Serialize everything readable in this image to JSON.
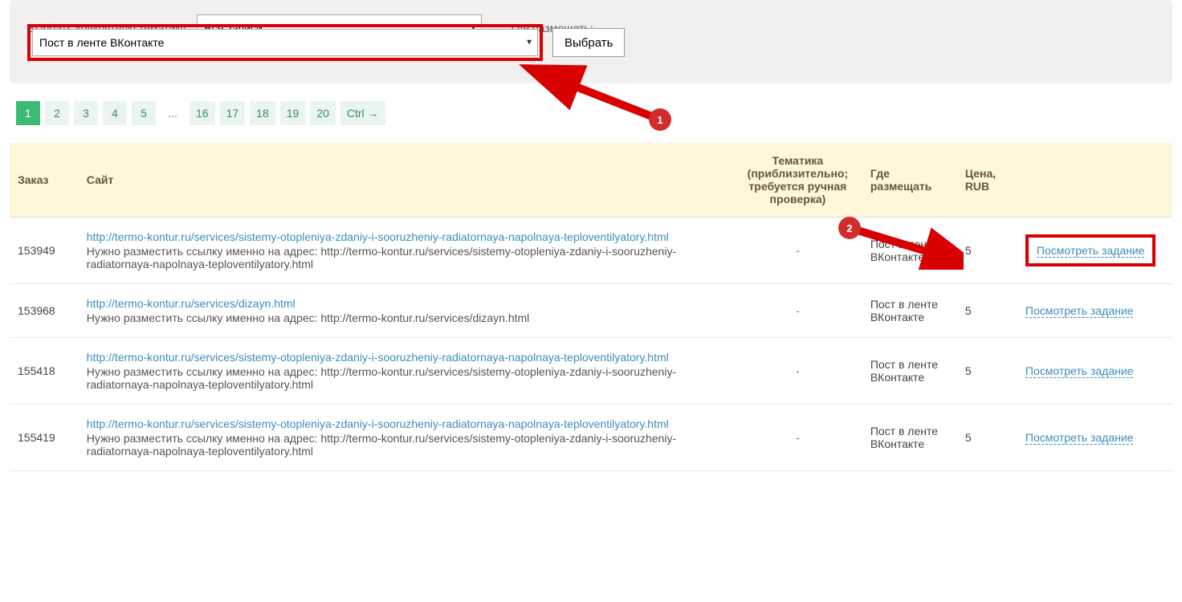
{
  "filters": {
    "topic_label": "Выбрать конкретную тематику:",
    "topic_value": "Все записи",
    "placement_label": "Где размещать:",
    "placement_value": "Пост в ленте ВКонтакте",
    "choose_button": "Выбрать"
  },
  "callout": {
    "badge1": "1",
    "badge2": "2"
  },
  "pagination": {
    "items": [
      "1",
      "2",
      "3",
      "4",
      "5",
      "...",
      "16",
      "17",
      "18",
      "19",
      "20",
      "Ctrl →"
    ],
    "active_index": 0
  },
  "table": {
    "headers": {
      "order": "Заказ",
      "site": "Сайт",
      "topic": "Тематика (приблизительно; требуется ручная проверка)",
      "place": "Где размещать",
      "price": "Цена, RUB",
      "action": ""
    },
    "action_label": "Посмотреть задание",
    "place_value": "Пост в ленте ВКонтакте",
    "topic_value": "-",
    "rows": [
      {
        "order": "153949",
        "url": "http://termo-kontur.ru/services/sistemy-otopleniya-zdaniy-i-sooruzheniy-radiatornaya-napolnaya-teploventilyatory.html",
        "desc": "Нужно разместить ссылку именно на адрес: http://termo-kontur.ru/services/sistemy-otopleniya-zdaniy-i-sooruzheniy-radiatornaya-napolnaya-teploventilyatory.html",
        "price": "5",
        "highlighted": true
      },
      {
        "order": "153968",
        "url": "http://termo-kontur.ru/services/dizayn.html",
        "desc": "Нужно разместить ссылку именно на адрес: http://termo-kontur.ru/services/dizayn.html",
        "price": "5",
        "highlighted": false
      },
      {
        "order": "155418",
        "url": "http://termo-kontur.ru/services/sistemy-otopleniya-zdaniy-i-sooruzheniy-radiatornaya-napolnaya-teploventilyatory.html",
        "desc": "Нужно разместить ссылку именно на адрес: http://termo-kontur.ru/services/sistemy-otopleniya-zdaniy-i-sooruzheniy-radiatornaya-napolnaya-teploventilyatory.html",
        "price": "5",
        "highlighted": false
      },
      {
        "order": "155419",
        "url": "http://termo-kontur.ru/services/sistemy-otopleniya-zdaniy-i-sooruzheniy-radiatornaya-napolnaya-teploventilyatory.html",
        "desc": "Нужно разместить ссылку именно на адрес: http://termo-kontur.ru/services/sistemy-otopleniya-zdaniy-i-sooruzheniy-radiatornaya-napolnaya-teploventilyatory.html",
        "price": "5",
        "highlighted": false
      }
    ]
  }
}
